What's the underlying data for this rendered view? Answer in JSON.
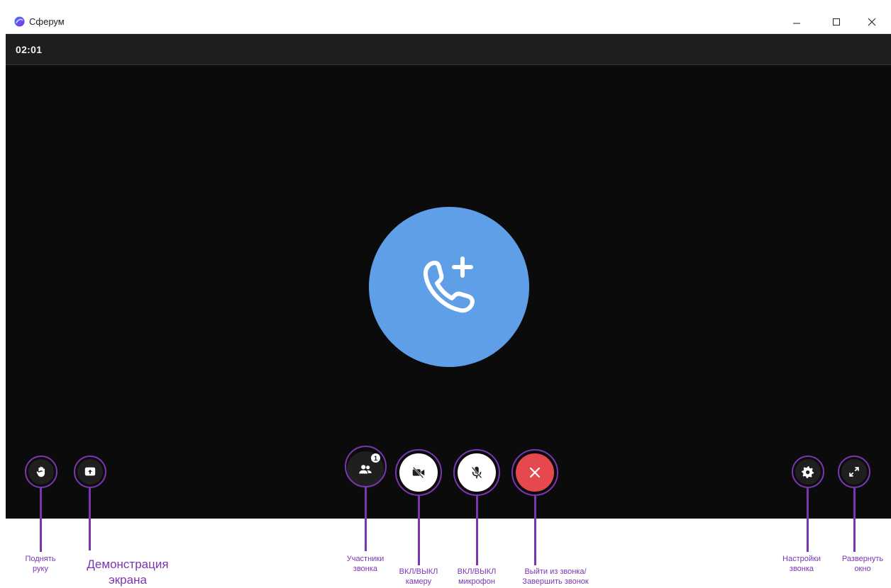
{
  "window": {
    "title": "Сферум",
    "colors": {
      "brand_blue": "#2a5bd7",
      "brand_purple": "#8a2be2"
    }
  },
  "call": {
    "timer": "02:01",
    "participants_count": "1"
  },
  "colors": {
    "call_button_blue": "#5f9fe8",
    "end_call_red": "#e5484d",
    "annotation_purple": "#7a35b0",
    "stage_background": "#0b0b0c"
  },
  "controls": {
    "raise_hand": {
      "icon": "raise-hand-icon",
      "label_line1": "Поднять",
      "label_line2": "руку"
    },
    "screen_share": {
      "icon": "screen-share-icon",
      "label_line1": "Демонстрация",
      "label_line2": "экрана"
    },
    "participants": {
      "icon": "participants-icon",
      "label_line1": "Участники",
      "label_line2": "звонка"
    },
    "camera": {
      "icon": "camera-off-icon",
      "label_line1": "ВКЛ/ВЫКЛ",
      "label_line2": "камеру"
    },
    "microphone": {
      "icon": "mic-off-icon",
      "label_line1": "ВКЛ/ВЫКЛ",
      "label_line2": "микрофон"
    },
    "end_call": {
      "icon": "close-icon",
      "label_line1": "Выйти из звонка/",
      "label_line2": "Завершить звонок"
    },
    "settings": {
      "icon": "gear-icon",
      "label_line1": "Настройки",
      "label_line2": "звонка"
    },
    "expand": {
      "icon": "expand-icon",
      "label_line1": "Развернуть",
      "label_line2": "окно"
    }
  },
  "invite": {
    "icon": "add-call-icon"
  }
}
